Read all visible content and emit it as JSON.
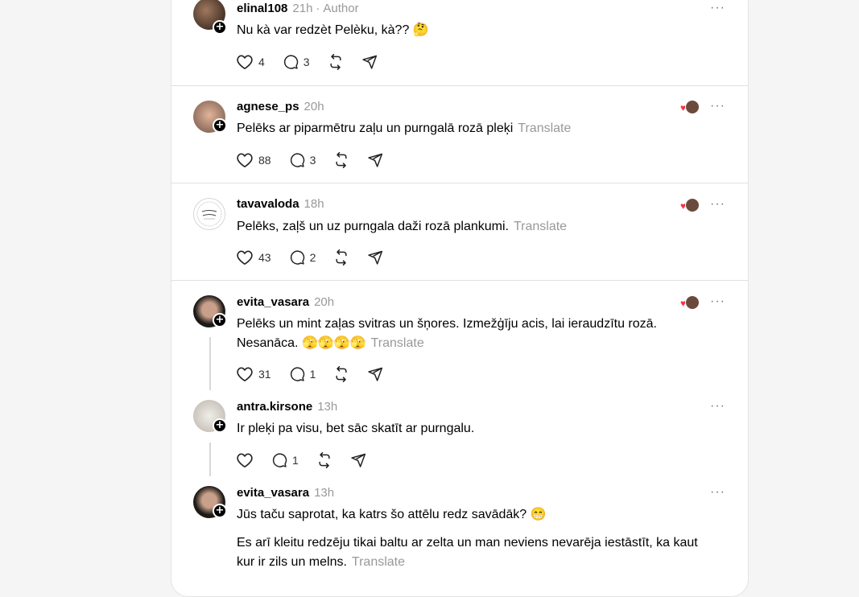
{
  "posts": [
    {
      "username": "elinal108",
      "time": "21h",
      "author_tag": "Author",
      "text": "Nu kà var redzèt Pelèku, kà?? 🤔",
      "likes": "4",
      "replies": "3"
    },
    {
      "username": "agnese_ps",
      "time": "20h",
      "text": "Pelēks ar piparmētru zaļu un purngalā rozā pleķi",
      "translate": "Translate",
      "likes": "88",
      "replies": "3"
    },
    {
      "username": "tavavaloda",
      "time": "18h",
      "text": "Pelēks, zaļš un uz purngala daži rozā plankumi.",
      "translate": "Translate",
      "likes": "43",
      "replies": "2"
    },
    {
      "username": "evita_vasara",
      "time": "20h",
      "text_line1": "Pelēks un mint zaļas svitras un šņores. Izmežģīju acis, lai ieraudzītu rozā.",
      "text_line2": "Nesanāca. 🫣🫣🫣🫣",
      "translate": "Translate",
      "likes": "31",
      "replies": "1"
    },
    {
      "username": "antra.kirsone",
      "time": "13h",
      "text": "Ir pleķi pa visu, bet sāc skatīt ar purngalu.",
      "likes": "",
      "replies": "1"
    },
    {
      "username": "evita_vasara",
      "time": "13h",
      "text": "Jūs taču saprotat, ka katrs šo attēlu redz savādāk? 😁",
      "text2_line1": "Es arī kleitu redzēju tikai baltu ar zelta un man neviens nevarēja iestāstīt, ka kaut",
      "text2_line2": "kur ir zils un melns.",
      "translate": "Translate"
    }
  ],
  "colors": {
    "accent_heart": "#ff3040",
    "muted_text": "#999999",
    "divider": "#e0e0e0"
  }
}
